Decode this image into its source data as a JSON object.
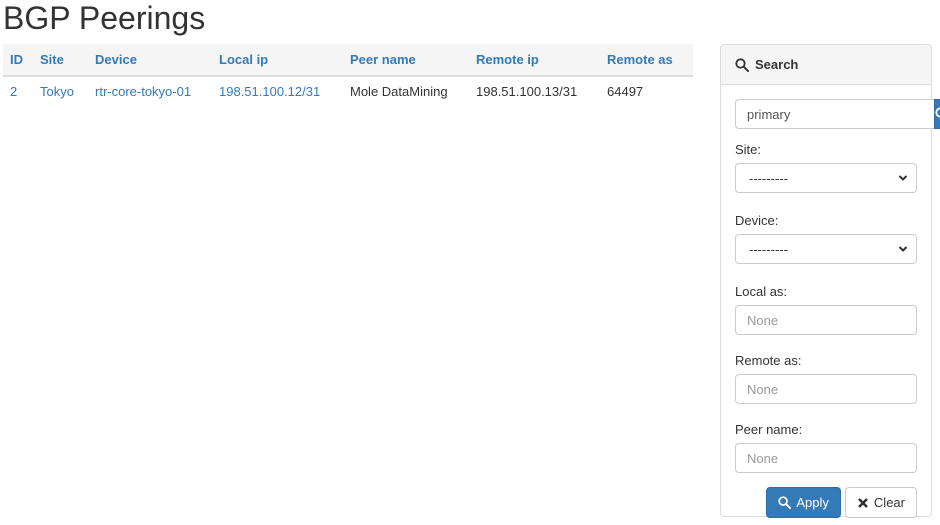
{
  "page": {
    "title": "BGP Peerings"
  },
  "table": {
    "columns": [
      "ID",
      "Site",
      "Device",
      "Local ip",
      "Peer name",
      "Remote ip",
      "Remote as"
    ],
    "rows": [
      {
        "id": "2",
        "site": "Tokyo",
        "device": "rtr-core-tokyo-01",
        "local_ip": "198.51.100.12/31",
        "peer_name": "Mole DataMining",
        "remote_ip": "198.51.100.13/31",
        "remote_as": "64497"
      }
    ]
  },
  "search_panel": {
    "title": "Search",
    "icon": "search-icon",
    "query_value": "primary",
    "fields": {
      "site": {
        "label": "Site:",
        "selected": "---------"
      },
      "device": {
        "label": "Device:",
        "selected": "---------"
      },
      "local_as": {
        "label": "Local as:",
        "placeholder": "None"
      },
      "remote_as": {
        "label": "Remote as:",
        "placeholder": "None"
      },
      "peer_name": {
        "label": "Peer name:",
        "placeholder": "None"
      }
    },
    "apply_label": "Apply",
    "clear_label": "Clear"
  },
  "colors": {
    "accent": "#337ab7",
    "header_bg": "#f5f5f5",
    "border": "#dddddd"
  }
}
